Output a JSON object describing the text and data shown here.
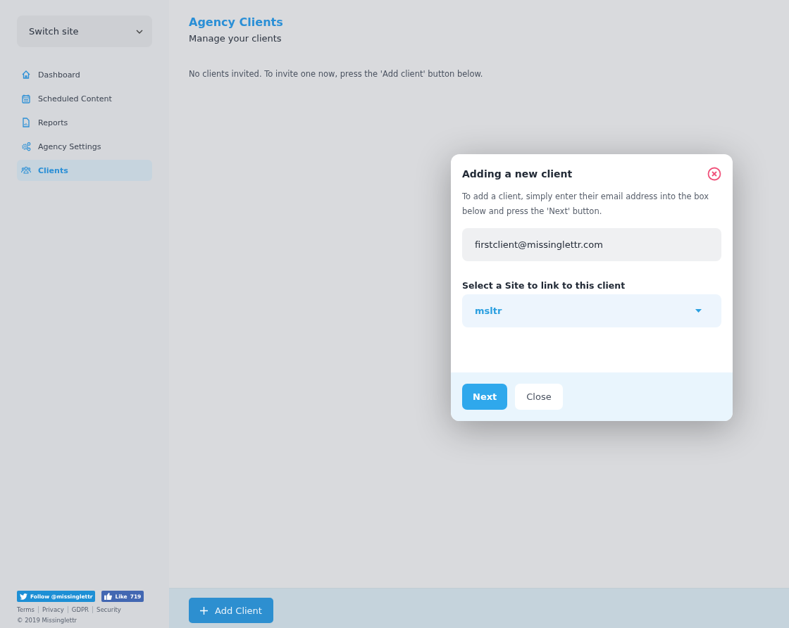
{
  "sidebar": {
    "site_switcher": {
      "label": "Switch site"
    },
    "items": [
      {
        "label": "Dashboard",
        "selected": false
      },
      {
        "label": "Scheduled Content",
        "selected": false
      },
      {
        "label": "Reports",
        "selected": false
      },
      {
        "label": "Agency Settings",
        "selected": false
      },
      {
        "label": "Clients",
        "selected": true
      }
    ],
    "social": {
      "follow": "Follow @missinglettr",
      "like": "Like",
      "like_count": "719"
    },
    "footer_links": [
      "Terms",
      "Privacy",
      "GDPR",
      "Security"
    ],
    "copyright": "© 2019 Missinglettr"
  },
  "page": {
    "title": "Agency Clients",
    "subtitle": "Manage your clients",
    "empty_message": "No clients invited. To invite one now, press the 'Add client' button below."
  },
  "bottom_bar": {
    "add_button": "Add Client"
  },
  "modal": {
    "title": "Adding a new client",
    "description": "To add a client, simply enter their email address into the box below and press the 'Next' button.",
    "email": "firstclient@missinglettr.com",
    "site_label": "Select a Site to link to this client",
    "site_value": "msltr",
    "buttons": [
      {
        "label": "Next",
        "kind": "primary"
      },
      {
        "label": "Close",
        "kind": "secondary"
      }
    ]
  }
}
